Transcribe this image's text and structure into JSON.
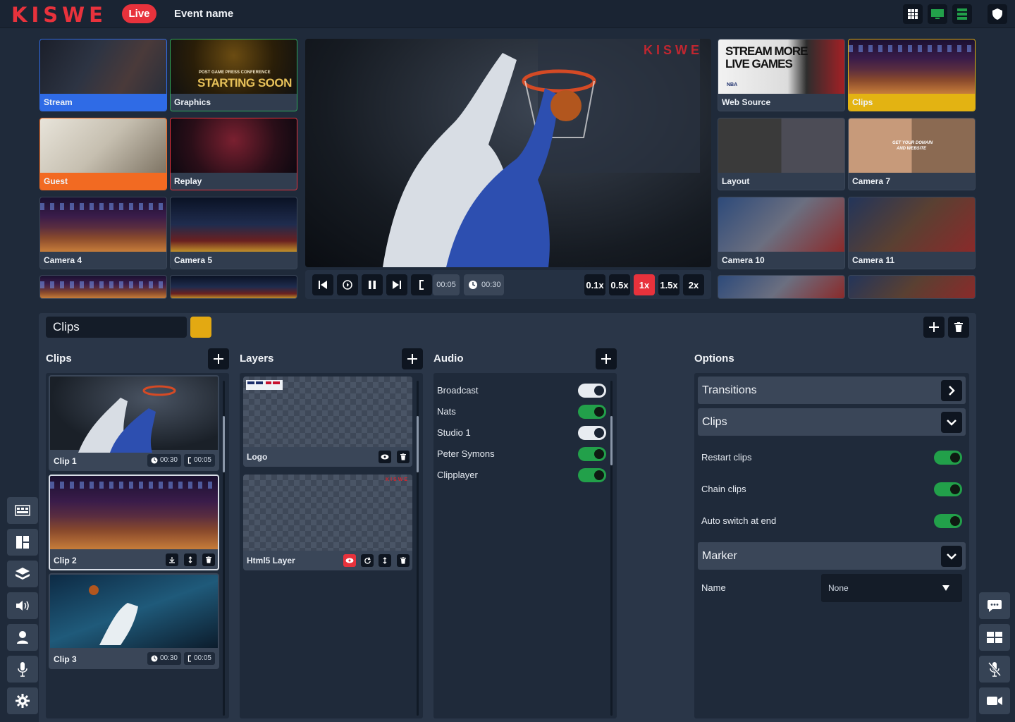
{
  "header": {
    "logo": "KISWE",
    "live_label": "Live",
    "event_name": "Event name"
  },
  "sources_left": [
    {
      "label": "Stream",
      "color": "#2f6be6"
    },
    {
      "label": "Graphics",
      "color": ""
    },
    {
      "label": "Guest",
      "color": "#f26a22"
    },
    {
      "label": "Replay",
      "color": ""
    },
    {
      "label": "Camera 4",
      "color": ""
    },
    {
      "label": "Camera 5",
      "color": ""
    }
  ],
  "sources_right": [
    {
      "label": "Web Source"
    },
    {
      "label": "Clips",
      "color": "#e3b312"
    },
    {
      "label": "Layout"
    },
    {
      "label": "Camera 7"
    },
    {
      "label": "Camera 10"
    },
    {
      "label": "Camera 11"
    }
  ],
  "graphics_text": {
    "line1": "POST GAME PRESS CONFERENCE",
    "line2": "STARTING SOON"
  },
  "websource_text": {
    "line1": "STREAM MORE",
    "line2": "LIVE GAMES",
    "line3": "NBA"
  },
  "cam7_text": {
    "line1": "GET YOUR DOMAIN",
    "line2": "AND WEBSITE"
  },
  "program": {
    "watermark": "KISWE"
  },
  "transport": {
    "in_time": "00:05",
    "duration": "00:30",
    "speeds": [
      "0.1x",
      "0.5x",
      "1x",
      "1.5x",
      "2x"
    ],
    "active_speed": "1x"
  },
  "panel": {
    "name_value": "Clips",
    "swatch_color": "#e3a912"
  },
  "clips": {
    "title": "Clips",
    "items": [
      {
        "label": "Clip 1",
        "duration": "00:30",
        "in_point": "00:05"
      },
      {
        "label": "Clip 2"
      },
      {
        "label": "Clip 3",
        "duration": "00:30",
        "in_point": "00:05"
      }
    ]
  },
  "layers": {
    "title": "Layers",
    "items": [
      {
        "label": "Logo"
      },
      {
        "label": "Html5 Layer",
        "watermark": "KISWE"
      }
    ]
  },
  "audio": {
    "title": "Audio",
    "channels": [
      {
        "label": "Broadcast",
        "on": false
      },
      {
        "label": "Nats",
        "on": true
      },
      {
        "label": "Studio 1",
        "on": false
      },
      {
        "label": "Peter Symons",
        "on": true
      },
      {
        "label": "Clipplayer",
        "on": true
      }
    ]
  },
  "options": {
    "title": "Options",
    "transitions": "Transitions",
    "clips_section": "Clips",
    "restart_clips": "Restart clips",
    "chain_clips": "Chain clips",
    "auto_switch": "Auto switch at end",
    "marker_section": "Marker",
    "name_label": "Name",
    "name_value": "None"
  }
}
